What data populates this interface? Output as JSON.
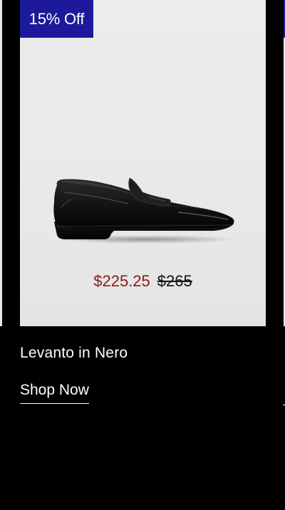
{
  "card": {
    "badge": "15% Off",
    "sale_price": "$225.25",
    "original_price": "$265",
    "product_name": "Levanto in Nero",
    "cta": "Shop Now",
    "image_icon": "black-penny-loafer-shoe"
  },
  "colors": {
    "badge_bg": "#1c1a9a",
    "sale_price": "#8b1a1a",
    "page_bg": "#000000"
  }
}
